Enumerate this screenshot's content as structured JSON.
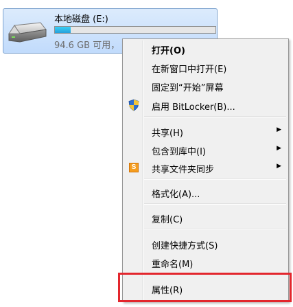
{
  "drive": {
    "name": "本地磁盘 (E:)",
    "free_text": "94.6 GB 可用，",
    "usage_fraction": 0.1
  },
  "menu": {
    "items": [
      {
        "label": "打开(O)",
        "bold": true
      },
      {
        "label": "在新窗口中打开(E)"
      },
      {
        "label": "固定到“开始”屏幕"
      },
      {
        "label": "启用 BitLocker(B)...",
        "icon": "shield-icon"
      },
      {
        "label": "共享(H)",
        "submenu": true
      },
      {
        "label": "包含到库中(I)",
        "submenu": true
      },
      {
        "label": "共享文件夹同步",
        "submenu": true,
        "icon": "sync-s-icon"
      },
      {
        "label": "格式化(A)..."
      },
      {
        "label": "复制(C)"
      },
      {
        "label": "创建快捷方式(S)"
      },
      {
        "label": "重命名(M)"
      },
      {
        "label": "属性(R)"
      }
    ]
  },
  "colors": {
    "highlight_border": "#e3262d",
    "drive_tile": "#c1dbfc",
    "menu_bg": "#f0f0f0"
  }
}
